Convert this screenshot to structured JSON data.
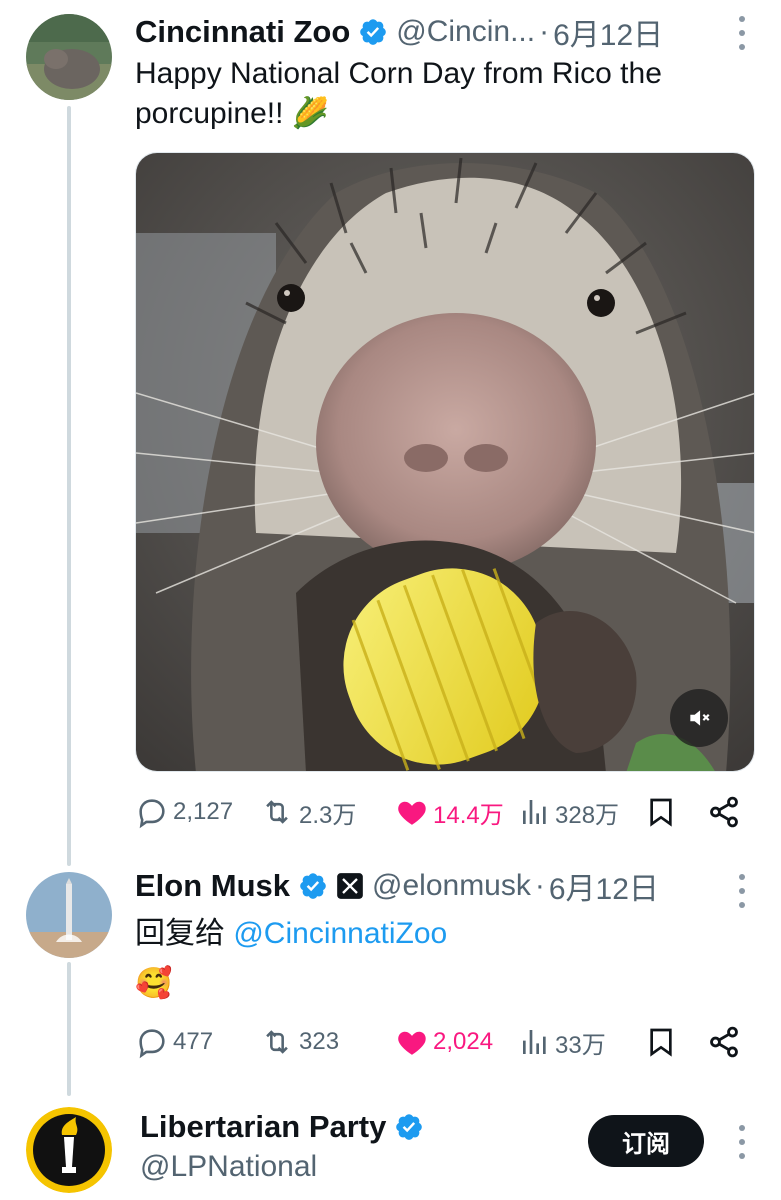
{
  "tweets": [
    {
      "name": "Cincinnati Zoo",
      "handle": "@Cincin...",
      "sep": "·",
      "time": "6月12日",
      "text_line1": "Happy National Corn Day from Rico the",
      "text_line2": "porcupine!! 🌽",
      "stats": {
        "replies": "2,127",
        "reposts": "2.3万",
        "likes": "14.4万",
        "views": "328万"
      }
    },
    {
      "name": "Elon Musk",
      "handle": "@elonmusk",
      "sep": "·",
      "time": "6月12日",
      "reply_prefix": "回复给",
      "reply_to": "@CincinnatiZoo",
      "text": "🥰",
      "stats": {
        "replies": "477",
        "reposts": "323",
        "likes": "2,024",
        "views": "33万"
      }
    },
    {
      "name": "Libertarian Party",
      "handle": "@LPNational",
      "follow_label": "订阅"
    }
  ],
  "colors": {
    "accent": "#1d9bf0",
    "like": "#f91880",
    "muted": "#536471"
  },
  "icons": [
    "verified-badge-icon",
    "more-icon",
    "reply-icon",
    "repost-icon",
    "like-icon",
    "views-icon",
    "bookmark-icon",
    "share-icon",
    "mute-icon",
    "x-affiliate-icon"
  ]
}
